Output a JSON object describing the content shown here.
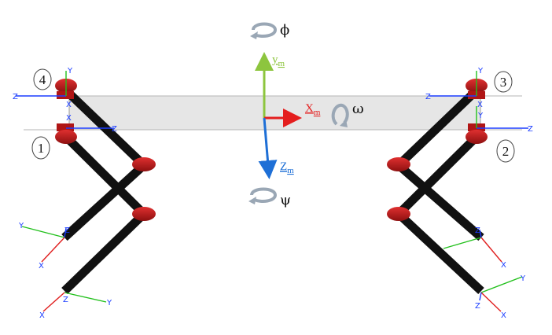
{
  "legs": [
    {
      "id": "4"
    },
    {
      "id": "1"
    },
    {
      "id": "3"
    },
    {
      "id": "2"
    }
  ],
  "body_frame": {
    "y_axis": {
      "letter": "y",
      "subscript": "m",
      "color": "#8dc53e"
    },
    "x_axis": {
      "letter": "X",
      "subscript": "m",
      "color": "#e41e1e"
    },
    "z_axis": {
      "letter": "Z",
      "subscript": "m",
      "color": "#1e6fd6"
    }
  },
  "rotations": {
    "phi": "ϕ",
    "omega": "ω",
    "psi": "ψ"
  },
  "joint_axis_letters": {
    "x": "X",
    "y": "Y",
    "z": "Z"
  },
  "colors": {
    "plate_fill": "#e6e6e6",
    "leg_link": "#111111",
    "joint": "#c91a1a",
    "axis_blue": "#1a3cff",
    "axis_green": "#22c01c",
    "axis_red": "#e01e1e"
  }
}
